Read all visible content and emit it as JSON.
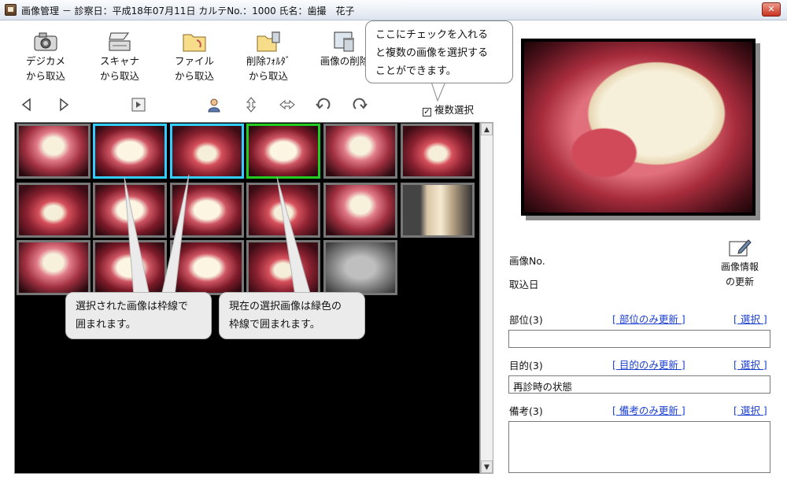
{
  "window": {
    "title": "画像管理 － 診察日：平成18年07月11日 カルテNo.：1000 氏名：歯撮　花子",
    "close_label": "✕"
  },
  "toolbar": {
    "camera_label": "デジカメ\nから取込",
    "scanner_label": "スキャナ\nから取込",
    "file_label": "ファイル\nから取込",
    "deleted_folder_label": "削除ﾌｫﾙﾀﾞ\nから取込",
    "delete_image_label": "画像の削除"
  },
  "multi_select": {
    "label": "複数選択",
    "checked_glyph": "✓"
  },
  "callouts": {
    "checkbox_hint": "ここにチェックを入れる\nと複数の画像を選択する\nことができます。",
    "selected_hint": "選択された画像は枠線で\n囲まれます。",
    "current_hint": "現在の選択画像は緑色の\n枠線で囲まれます。"
  },
  "info": {
    "image_no_label": "画像No.",
    "import_date_label": "取込日",
    "update_info_label": "画像情報\nの更新",
    "part_label": "部位(3)",
    "part_update_link": "[ 部位のみ更新 ]",
    "part_select_link": "[ 選択 ]",
    "part_value": "",
    "purpose_label": "目的(3)",
    "purpose_update_link": "[ 目的のみ更新 ]",
    "purpose_select_link": "[ 選択 ]",
    "purpose_value": "再診時の状態",
    "note_label": "備考(3)",
    "note_update_link": "[ 備考のみ更新 ]",
    "note_select_link": "[ 選択 ]",
    "note_value": ""
  },
  "colors": {
    "selected_border": "#33ccff",
    "current_border": "#22cc22",
    "link": "#1a3fd0"
  },
  "thumbnails_summary": {
    "rows": 3,
    "count": 17
  }
}
